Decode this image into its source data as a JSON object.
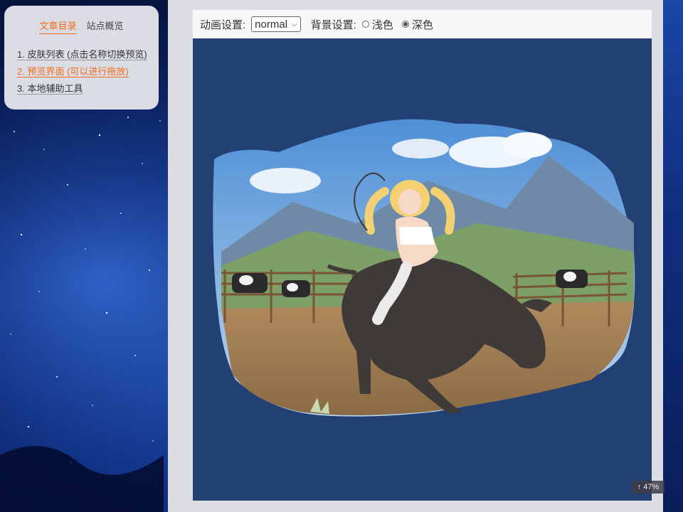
{
  "toc": {
    "tabs": [
      {
        "label": "文章目录",
        "active": true
      },
      {
        "label": "站点概览",
        "active": false
      }
    ],
    "items": [
      {
        "label": "1. 皮肤列表 (点击名称切换预览)",
        "active": false
      },
      {
        "label": "2. 预览界面 (可以进行拖放)",
        "active": true
      },
      {
        "label": "3. 本地辅助工具",
        "active": false
      }
    ]
  },
  "toolbar": {
    "animation_label": "动画设置:",
    "animation_value": "normal",
    "background_label": "背景设置:",
    "options": [
      {
        "label": "浅色",
        "checked": false
      },
      {
        "label": "深色",
        "checked": true
      }
    ]
  },
  "preview": {
    "background_color": "#234075"
  },
  "scroll_badge": {
    "icon": "arrow-up-icon",
    "text": "47%"
  },
  "colors": {
    "accent": "#f26b1d",
    "stage": "#234075"
  }
}
